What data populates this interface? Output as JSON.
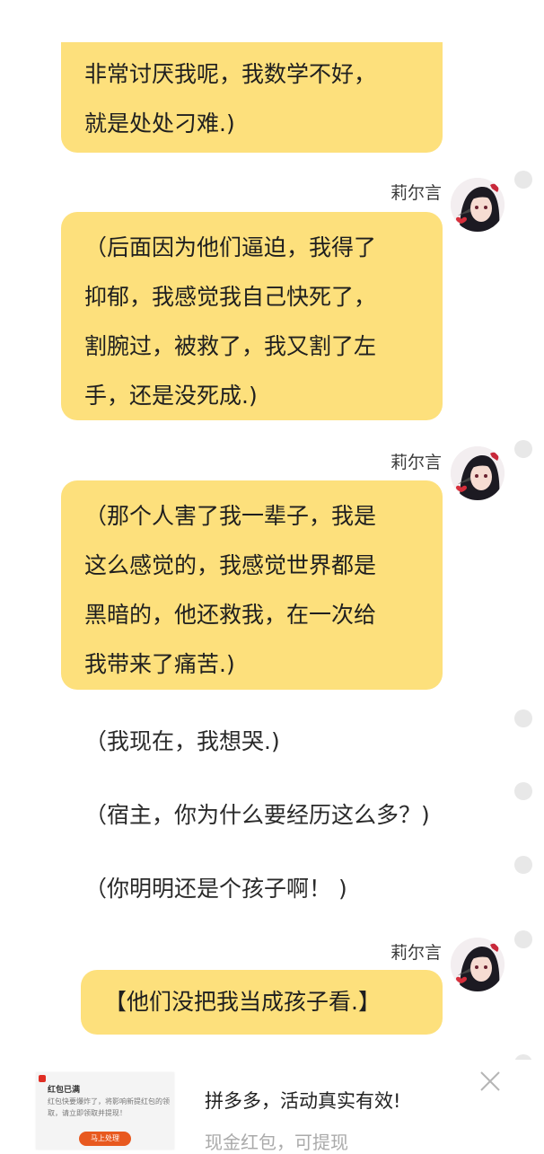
{
  "messages": [
    {
      "type": "bubble",
      "lines": [
        "非常讨厌我呢，我数学不好，",
        "就是处处刁难.)"
      ]
    },
    {
      "type": "bubble",
      "sender": "莉尔言",
      "lines": [
        "（后面因为他们逼迫，我得了",
        "抑郁，我感觉我自己快死了，",
        "割腕过，被救了，我又割了左",
        "手，还是没死成.)"
      ]
    },
    {
      "type": "bubble",
      "sender": "莉尔言",
      "lines": [
        "（那个人害了我一辈子，我是",
        "这么感觉的，我感觉世界都是",
        "黑暗的，他还救我，在一次给",
        "我带来了痛苦.)"
      ]
    },
    {
      "type": "text",
      "text": "（我现在，我想哭.)"
    },
    {
      "type": "text",
      "text": "（宿主，你为什么要经历这么多？)"
    },
    {
      "type": "text",
      "text": "（你明明还是个孩子啊！ )"
    },
    {
      "type": "bubble",
      "sender": "莉尔言",
      "text": "【他们没把我当成孩子看.】"
    }
  ],
  "ad": {
    "thumb_title": "红包已满",
    "thumb_desc": "红包快要爆炸了，将影响新提红包的领取，请立即领取并提现！",
    "thumb_button": "马上处理",
    "title": "拼多多，活动真实有效!",
    "subtitle": "现金红包，可提现",
    "close_icon": "close-icon",
    "brand_color": "#e02e24"
  },
  "colors": {
    "bubble": "#fde07c",
    "dot": "#e8e8e8"
  }
}
